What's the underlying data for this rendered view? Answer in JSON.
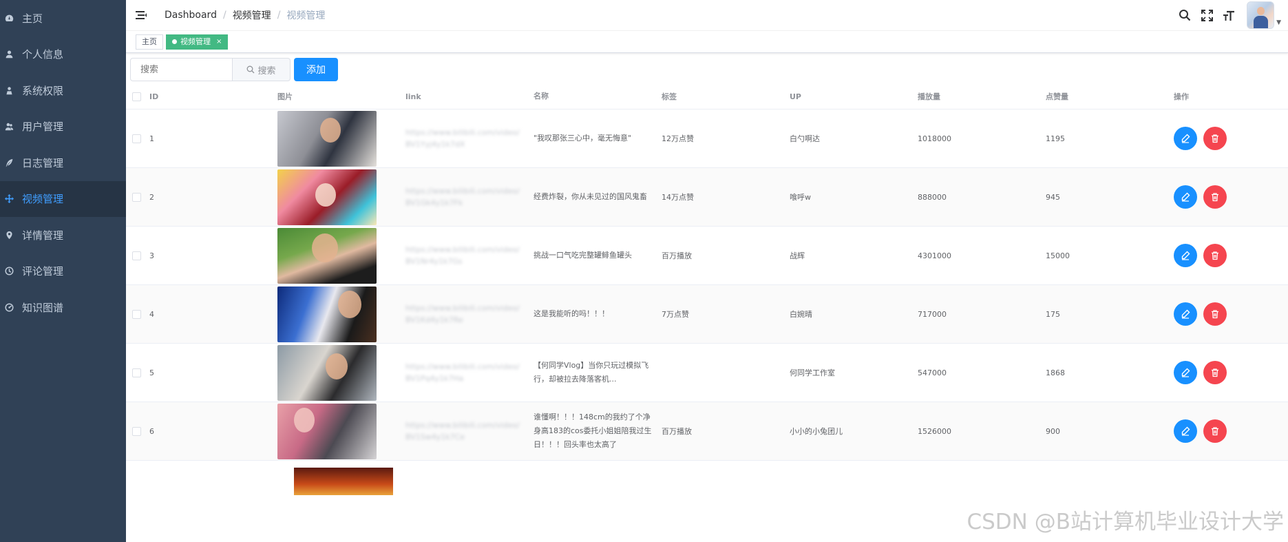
{
  "sidebar": {
    "items": [
      {
        "label": "主页",
        "icon": "dashboard-icon"
      },
      {
        "label": "个人信息",
        "icon": "user-icon"
      },
      {
        "label": "系统权限",
        "icon": "peoples-icon"
      },
      {
        "label": "用户管理",
        "icon": "users-icon"
      },
      {
        "label": "日志管理",
        "icon": "feather-icon"
      },
      {
        "label": "视频管理",
        "icon": "move-icon"
      },
      {
        "label": "详情管理",
        "icon": "location-icon"
      },
      {
        "label": "评论管理",
        "icon": "clock-icon"
      },
      {
        "label": "知识图谱",
        "icon": "chart-icon"
      }
    ],
    "active_index": 5,
    "active_color": "#409eff",
    "bg_color": "#304156"
  },
  "navbar": {
    "breadcrumb": [
      "Dashboard",
      "视频管理",
      "视频管理"
    ],
    "icons": [
      "search-icon",
      "fullscreen-icon",
      "font-size-icon",
      "avatar"
    ]
  },
  "tags_view": {
    "tags": [
      {
        "label": "主页",
        "active": false
      },
      {
        "label": "视频管理",
        "active": true,
        "close": "×"
      }
    ],
    "active_color": "#42b983"
  },
  "toolbar": {
    "search_placeholder": "搜索",
    "search_button": "搜索",
    "add_button": "添加",
    "add_color": "#1890ff"
  },
  "table": {
    "columns": [
      "ID",
      "图片",
      "link",
      "名称",
      "标签",
      "UP",
      "播放量",
      "点赞量",
      "操作"
    ],
    "rows": [
      {
        "id": "1",
        "link": "https://www.bilibili.com/video/BV1Yyj4y1k7dX",
        "name": "\"我叹那张三心中，毫无悔意\"",
        "tag": "12万点赞",
        "up": "白勺啊达",
        "play": "1018000",
        "like": "1195"
      },
      {
        "id": "2",
        "link": "https://www.bilibili.com/video/BV1Gk4y1k7Fk",
        "name": "经费炸裂，你从未见过的国风鬼畜",
        "tag": "14万点赞",
        "up": "喰呼w",
        "play": "888000",
        "like": "945"
      },
      {
        "id": "3",
        "link": "https://www.bilibili.com/video/BV1Nr4y1k7Gs",
        "name": "挑战一口气吃完整罐鲱鱼罐头",
        "tag": "百万播放",
        "up": "战辉",
        "play": "4301000",
        "like": "15000"
      },
      {
        "id": "4",
        "link": "https://www.bilibili.com/video/BV1Kd4y1k7Re",
        "name": "这是我能听的吗！！！",
        "tag": "7万点赞",
        "up": "白婉晴",
        "play": "717000",
        "like": "175"
      },
      {
        "id": "5",
        "link": "https://www.bilibili.com/video/BV1Pq4y1k7Ha",
        "name": "【何同学Vlog】当你只玩过模拟飞行，却被拉去降落客机...",
        "tag": "",
        "up": "何同学工作室",
        "play": "547000",
        "like": "1868"
      },
      {
        "id": "6",
        "link": "https://www.bilibili.com/video/BV1Sw4y1k7Ce",
        "name": "谁懂啊！！！148cm的我约了个净身高183的cos委托小姐姐陪我过生日！！！回头率也太高了",
        "tag": "百万播放",
        "up": "小小的小兔团儿",
        "play": "1526000",
        "like": "900"
      }
    ],
    "edit_icon": "edit-icon",
    "delete_icon": "delete-icon",
    "edit_color": "#1890ff",
    "delete_color": "#f5454f"
  },
  "watermark": "CSDN @B站计算机毕业设计大学"
}
